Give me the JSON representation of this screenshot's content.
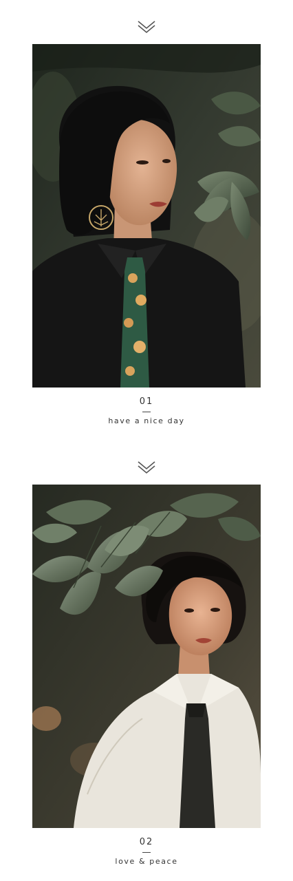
{
  "sections": [
    {
      "number": "01",
      "caption": "have a nice day",
      "chevron_icon": "double-chevron-down-icon"
    },
    {
      "number": "02",
      "caption": "love & peace",
      "chevron_icon": "double-chevron-down-icon"
    }
  ],
  "colors": {
    "background": "#ffffff",
    "text": "#333333",
    "photo1_base": "#2b3227",
    "photo2_base": "#3a3c30"
  }
}
